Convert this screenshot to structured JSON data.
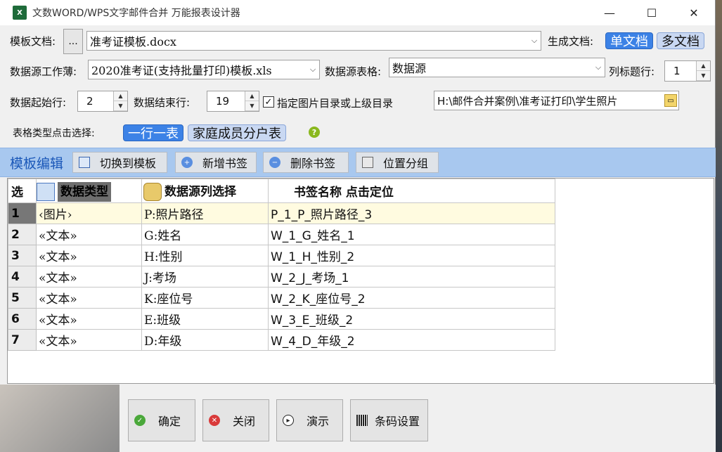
{
  "window": {
    "title": "文数WORD/WPS文字邮件合并 万能报表设计器",
    "app_icon": "xls-icon",
    "controls": [
      "—",
      "☐",
      "✕"
    ]
  },
  "template": {
    "label": "模板文档:",
    "browse_label": "...",
    "value": "准考证模板.docx"
  },
  "generate": {
    "label": "生成文档:",
    "single": "单文档",
    "multi": "多文档"
  },
  "source": {
    "workbook_label": "数据源工作薄:",
    "workbook_value": "2020准考证(支持批量打印)模板.xls",
    "sheet_label": "数据源表格:",
    "sheet_value": "数据源",
    "header_row_label": "列标题行:",
    "header_row_value": "1"
  },
  "range": {
    "start_label": "数据起始行:",
    "start_value": "2",
    "end_label": "数据结束行:",
    "end_value": "19",
    "image_dir_checked": true,
    "image_dir_label": "指定图片目录或上级目录",
    "image_dir_value": "H:\\邮件合并案例\\准考证打印\\学生照片"
  },
  "table_type": {
    "label": "表格类型点击选择:",
    "option1": "一行一表",
    "option2": "家庭成员分户表"
  },
  "toolbar": {
    "title": "模板编辑",
    "switch": "切换到模板",
    "add": "新增书签",
    "delete": "删除书签",
    "group": "位置分组"
  },
  "grid": {
    "headers": {
      "sel": "选",
      "type": "数据类型",
      "source": "数据源列选择",
      "bookmark": "书签名称 点击定位"
    },
    "rows": [
      {
        "n": "1",
        "type": "‹图片›",
        "source": "P:照片路径",
        "bookmark": "P_1_P_照片路径_3"
      },
      {
        "n": "2",
        "type": "«文本»",
        "source": "G:姓名",
        "bookmark": "W_1_G_姓名_1"
      },
      {
        "n": "3",
        "type": "«文本»",
        "source": "H:性别",
        "bookmark": "W_1_H_性别_2"
      },
      {
        "n": "4",
        "type": "«文本»",
        "source": "J:考场",
        "bookmark": "W_2_J_考场_1"
      },
      {
        "n": "5",
        "type": "«文本»",
        "source": "K:座位号",
        "bookmark": "W_2_K_座位号_2"
      },
      {
        "n": "6",
        "type": "«文本»",
        "source": "E:班级",
        "bookmark": "W_3_E_班级_2"
      },
      {
        "n": "7",
        "type": "«文本»",
        "source": "D:年级",
        "bookmark": "W_4_D_年级_2"
      }
    ]
  },
  "footer": {
    "ok": "确定",
    "close": "关闭",
    "demo": "演示",
    "barcode": "条码设置"
  }
}
